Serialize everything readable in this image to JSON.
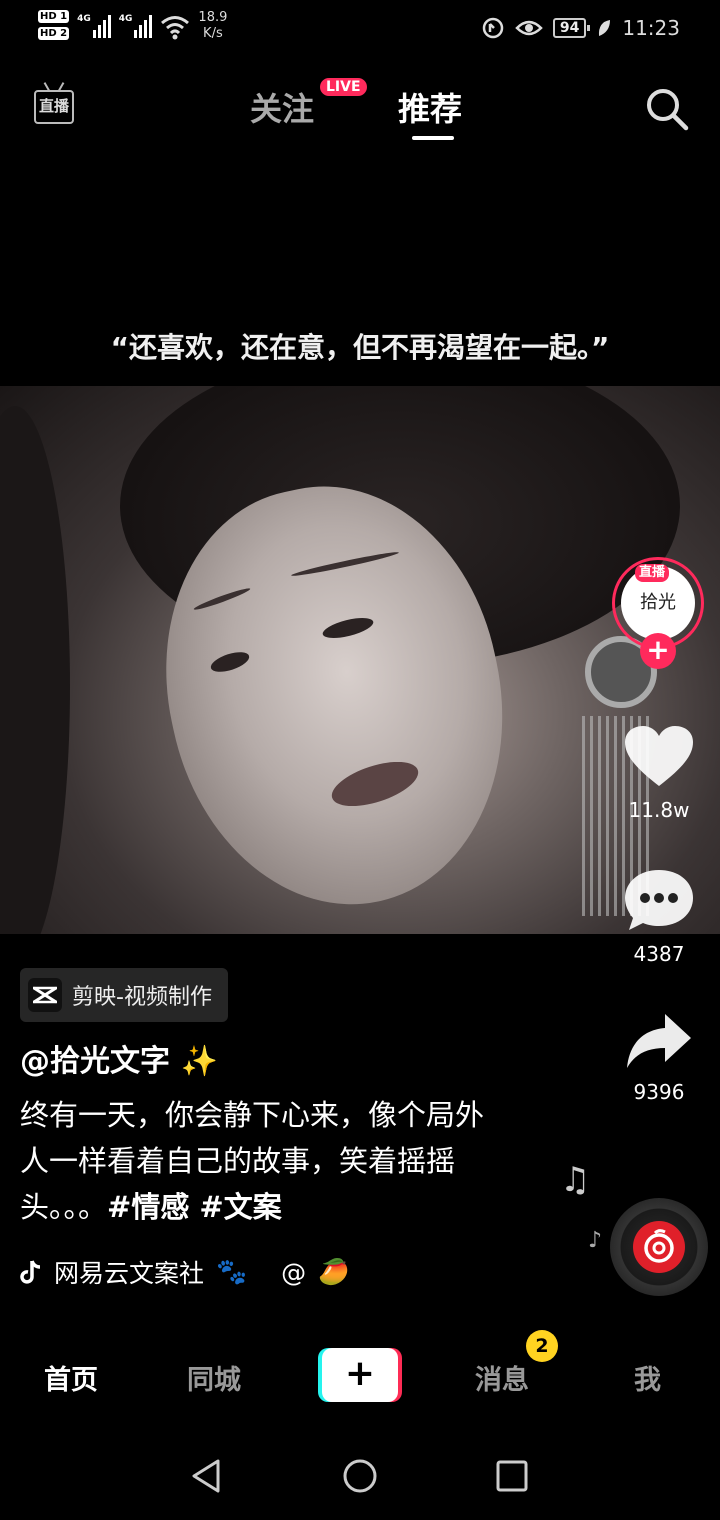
{
  "status_bar": {
    "hd1": "HD 1",
    "hd2": "HD 2",
    "net1": "4G",
    "net2": "4G",
    "speed_value": "18.9",
    "speed_unit": "K/s",
    "battery": "94",
    "time": "11:23"
  },
  "top_nav": {
    "live_icon_label": "直播",
    "tab_follow": "关注",
    "live_badge": "LIVE",
    "tab_recommend": "推荐"
  },
  "caption": "“还喜欢，还在意，但不再渴望在一起。”",
  "right_rail": {
    "avatar_live": "直播",
    "avatar_text": "拾光",
    "likes": "11.8w",
    "comments": "4387",
    "shares": "9396"
  },
  "post": {
    "app_tag": "剪映-视频制作",
    "author": "@拾光文字",
    "author_emoji": "✨",
    "description": "终有一天，你会静下心来，像个局外人一样看着自己的故事，笑着摇摇头。。。",
    "hashtags": "#情感 #文案",
    "music": "网易云文案社",
    "music_emoji": "🐾",
    "music_at": "@",
    "music_at_emoji": "🥭"
  },
  "tab_bar": {
    "home": "首页",
    "nearby": "同城",
    "plus": "+",
    "messages": "消息",
    "messages_badge": "2",
    "me": "我"
  },
  "colors": {
    "accent_pink": "#fe2c55",
    "accent_cyan": "#25f4ee",
    "badge_yellow": "#ffd321"
  }
}
